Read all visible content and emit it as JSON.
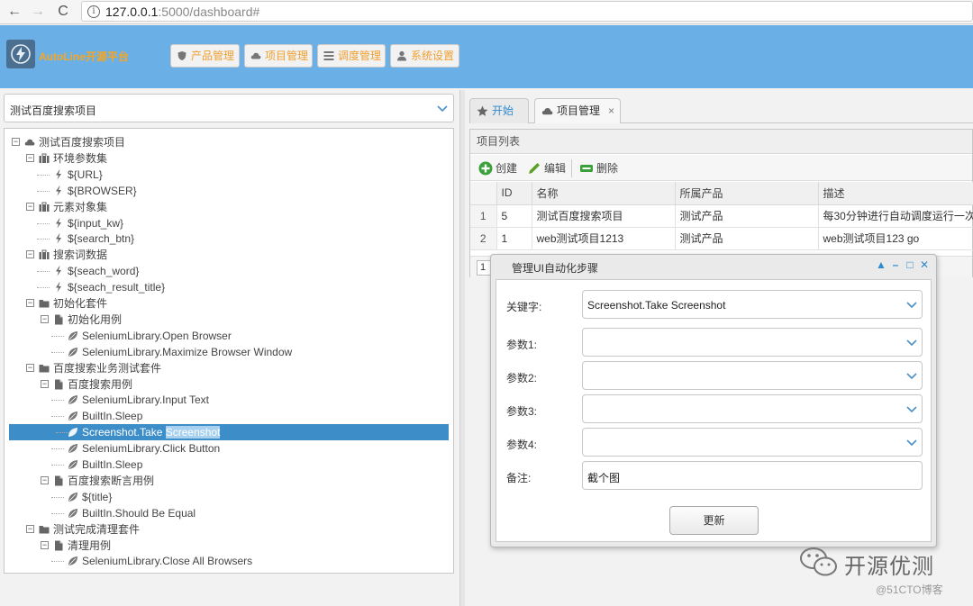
{
  "browser": {
    "url_host": "127.0.0.1",
    "url_rest": ":5000/dashboard#",
    "back_glyph": "←",
    "forward_glyph": "→",
    "reload_glyph": "C",
    "info_glyph": "i"
  },
  "header": {
    "app_name": "AutoLine开源平台",
    "menus": [
      {
        "label": "产品管理",
        "icon": "shield-icon"
      },
      {
        "label": "项目管理",
        "icon": "cloud-icon"
      },
      {
        "label": "调度管理",
        "icon": "list-icon"
      },
      {
        "label": "系统设置",
        "icon": "user-icon"
      }
    ],
    "accent_color": "#f6a623",
    "bar_color": "#6ab0e6"
  },
  "left": {
    "project_select": "测试百度搜索项目",
    "tree": [
      {
        "label": "测试百度搜索项目",
        "icon": "cloud-icon",
        "level": 0,
        "toggle": "−"
      },
      {
        "label": "环境参数集",
        "icon": "briefcase-icon",
        "level": 1,
        "toggle": "−"
      },
      {
        "label": "${URL}",
        "icon": "bolt-icon",
        "level": 2
      },
      {
        "label": "${BROWSER}",
        "icon": "bolt-icon",
        "level": 2
      },
      {
        "label": "元素对象集",
        "icon": "briefcase-icon",
        "level": 1,
        "toggle": "−"
      },
      {
        "label": "${input_kw}",
        "icon": "bolt-icon",
        "level": 2
      },
      {
        "label": "${search_btn}",
        "icon": "bolt-icon",
        "level": 2
      },
      {
        "label": "搜索词数据",
        "icon": "briefcase-icon",
        "level": 1,
        "toggle": "−"
      },
      {
        "label": "${seach_word}",
        "icon": "bolt-icon",
        "level": 2
      },
      {
        "label": "${seach_result_title}",
        "icon": "bolt-icon",
        "level": 2
      },
      {
        "label": "初始化套件",
        "icon": "folder-icon",
        "level": 1,
        "toggle": "−"
      },
      {
        "label": "初始化用例",
        "icon": "file-icon",
        "level": 2,
        "toggle": "−"
      },
      {
        "label": "SeleniumLibrary.Open Browser",
        "icon": "leaf-icon",
        "level": 3
      },
      {
        "label": "SeleniumLibrary.Maximize Browser Window",
        "icon": "leaf-icon",
        "level": 3
      },
      {
        "label": "百度搜索业务测试套件",
        "icon": "folder-icon",
        "level": 1,
        "toggle": "−"
      },
      {
        "label": "百度搜索用例",
        "icon": "file-icon",
        "level": 2,
        "toggle": "−"
      },
      {
        "label": "SeleniumLibrary.Input Text",
        "icon": "leaf-icon",
        "level": 3
      },
      {
        "label": "BuiltIn.Sleep",
        "icon": "leaf-icon",
        "level": 3
      },
      {
        "label": "Screenshot.Take ",
        "label_hl": "Screenshot",
        "icon": "leaf-icon",
        "level": 3,
        "selected": true
      },
      {
        "label": "SeleniumLibrary.Click Button",
        "icon": "leaf-icon",
        "level": 3
      },
      {
        "label": "BuiltIn.Sleep",
        "icon": "leaf-icon",
        "level": 3
      },
      {
        "label": "百度搜索断言用例",
        "icon": "file-icon",
        "level": 2,
        "toggle": "−"
      },
      {
        "label": "${title}",
        "icon": "leaf-icon",
        "level": 3
      },
      {
        "label": "BuiltIn.Should Be Equal",
        "icon": "leaf-icon",
        "level": 3
      },
      {
        "label": "测试完成清理套件",
        "icon": "folder-icon",
        "level": 1,
        "toggle": "−"
      },
      {
        "label": "清理用例",
        "icon": "file-icon",
        "level": 2,
        "toggle": "−"
      },
      {
        "label": "SeleniumLibrary.Close All Browsers",
        "icon": "leaf-icon",
        "level": 3
      }
    ]
  },
  "right": {
    "tabs": [
      {
        "label": "开始",
        "icon": "star-icon"
      },
      {
        "label": "项目管理",
        "icon": "cloud-icon",
        "close": "×"
      }
    ],
    "panel_title": "项目列表",
    "toolbar": [
      {
        "label": "创建",
        "icon": "plus-icon"
      },
      {
        "label": "编辑",
        "icon": "pencil-icon"
      },
      {
        "label": "删除",
        "icon": "minus-icon"
      }
    ],
    "columns": [
      "ID",
      "名称",
      "所属产品",
      "描述"
    ],
    "rows": [
      {
        "n": "1",
        "id": "5",
        "name": "测试百度搜索项目",
        "product": "测试产品",
        "desc": "每30分钟进行自动调度运行一次"
      },
      {
        "n": "2",
        "id": "1",
        "name": "web测试项目1213",
        "product": "测试产品",
        "desc": "web测试项目123 go"
      }
    ],
    "page_number": "1"
  },
  "dialog": {
    "title": "管理UI自动化步骤",
    "tools": [
      "▲",
      "–",
      "□",
      "✕"
    ],
    "fields": [
      {
        "label": "关键字:",
        "value": "Screenshot.Take Screenshot",
        "type": "combo"
      },
      {
        "label": "参数1:",
        "value": "",
        "type": "combo"
      },
      {
        "label": "参数2:",
        "value": "",
        "type": "combo"
      },
      {
        "label": "参数3:",
        "value": "",
        "type": "combo"
      },
      {
        "label": "参数4:",
        "value": "",
        "type": "combo"
      },
      {
        "label": "备注:",
        "value": "截个图",
        "type": "text"
      }
    ],
    "update_label": "更新"
  },
  "watermark": {
    "text": "开源优测",
    "sub": "@51CTO博客"
  }
}
